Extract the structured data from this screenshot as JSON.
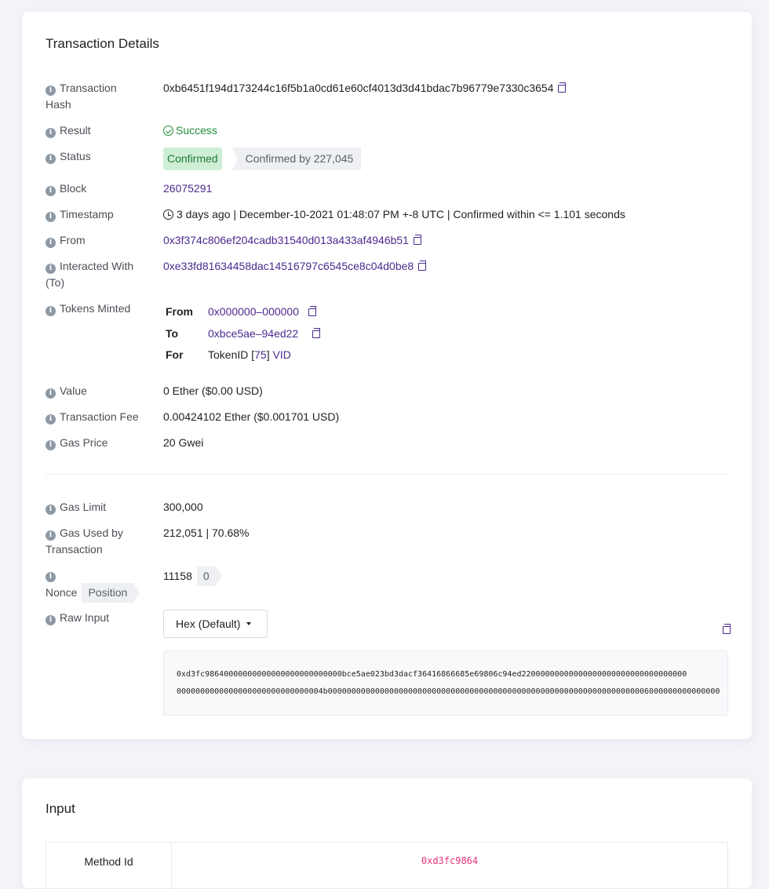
{
  "details": {
    "title": "Transaction Details",
    "tx_hash_label_1": "Transaction",
    "tx_hash_label_2": "Hash",
    "tx_hash": "0xb6451f194d173244c16f5b1a0cd61e60cf4013d3d41bdac7b96779e7330c3654",
    "result_label": "Result",
    "result": "Success",
    "status_label": "Status",
    "status": "Confirmed",
    "confirmed_by": "Confirmed by 227,045",
    "block_label": "Block",
    "block": "26075291",
    "timestamp_label": "Timestamp",
    "timestamp": "3 days ago | December-10-2021 01:48:07 PM +-8 UTC | Confirmed within <= 1.101 seconds",
    "from_label": "From",
    "from": "0x3f374c806ef204cadb31540d013a433af4946b51",
    "to_label_1": "Interacted With",
    "to_label_2": "(To)",
    "to": "0xe33fd81634458dac14516797c6545ce8c04d0be8",
    "tokens_label": "Tokens Minted",
    "tokens": {
      "from_key": "From",
      "from_val": "0x000000–000000",
      "to_key": "To",
      "to_val": "0xbce5ae–94ed22",
      "for_key": "For",
      "for_prefix": "TokenID [",
      "token_id": "75",
      "for_suffix": "]",
      "token_name": "VID"
    },
    "value_label": "Value",
    "value": "0 Ether ($0.00 USD)",
    "fee_label": "Transaction Fee",
    "fee": "0.00424102 Ether ($0.001701 USD)",
    "gas_price_label": "Gas Price",
    "gas_price": "20 Gwei",
    "gas_limit_label": "Gas Limit",
    "gas_limit": "300,000",
    "gas_used_label_1": "Gas Used by",
    "gas_used_label_2": "Transaction",
    "gas_used": "212,051 | 70.68%",
    "nonce_label": "Nonce",
    "position_label": "Position",
    "nonce": "11158",
    "position": "0",
    "raw_label": "Raw Input",
    "raw_format": "Hex (Default)",
    "raw_line_1": "0xd3fc98640000000000000000000000000bce5ae023bd3dacf36416866685e69806c94ed22000000000000000000000000000000000",
    "raw_line_2": "0000000000000000000000000000004b00000000000000000000000000000000000000000000000000000000000000000006000000000000000"
  },
  "input": {
    "title": "Input",
    "method_id_label": "Method Id",
    "method_id": "0xd3fc9864"
  },
  "colors": {
    "link": "#4b2a8e",
    "success": "#1f8e3b",
    "method_id": "#e3337c"
  }
}
